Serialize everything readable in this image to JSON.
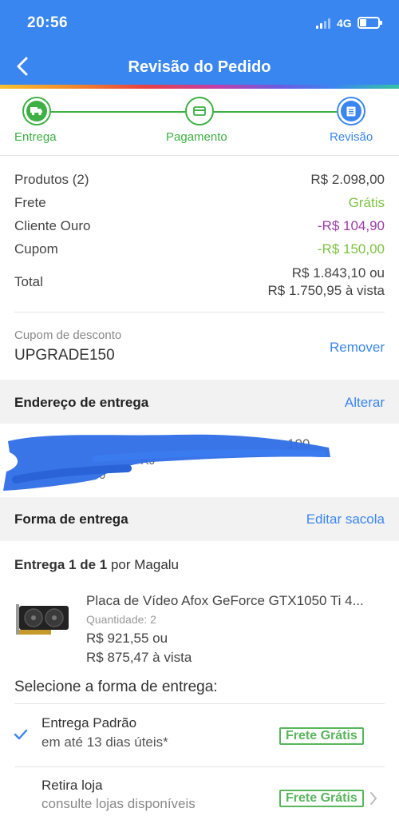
{
  "status": {
    "time": "20:56",
    "network": "4G"
  },
  "header": {
    "title": "Revisão do Pedido"
  },
  "colors": {
    "primary": "#3a86f0",
    "success": "#3cb043",
    "purple": "#9b3aa8",
    "free": "#7cc242"
  },
  "steps": [
    {
      "label": "Entrega",
      "icon": "truck-icon",
      "state": "done"
    },
    {
      "label": "Pagamento",
      "icon": "card-icon",
      "state": "done"
    },
    {
      "label": "Revisão",
      "icon": "list-icon",
      "state": "current"
    }
  ],
  "summary": {
    "products_label": "Produtos (2)",
    "products_value": "R$ 2.098,00",
    "shipping_label": "Frete",
    "shipping_value": "Grátis",
    "gold_label": "Cliente Ouro",
    "gold_value": "-R$ 104,90",
    "coupon_label": "Cupom",
    "coupon_value": "-R$ 150,00",
    "total_label": "Total",
    "total_value": "R$ 1.843,10 ou",
    "total_cash": "R$ 1.750,95 à vista"
  },
  "coupon": {
    "label": "Cupom de desconto",
    "code": "UPGRADE150",
    "remove": "Remover"
  },
  "address": {
    "title": "Endereço de entrega",
    "change": "Alterar",
    "number_fragment": "100",
    "state_fragment": "RJ",
    "zip_fragment": "0"
  },
  "delivery": {
    "title": "Forma de entrega",
    "edit": "Editar sacola",
    "shipment": "Entrega 1 de 1",
    "shipment_by": "por Magalu",
    "product": {
      "name": "Placa de Vídeo Afox GeForce GTX1050 Ti 4...",
      "quantity": "Quantidade: 2",
      "price": "R$ 921,55 ou",
      "price_cash": "R$ 875,47 à vista"
    },
    "select_title": "Selecione a forma de entrega:",
    "options": [
      {
        "name": "Entrega Padrão",
        "detail": "em até 13 dias úteis*",
        "badge": "Frete Grátis",
        "selected": true
      },
      {
        "name": "Retira loja",
        "detail": "consulte lojas disponíveis",
        "badge": "Frete Grátis",
        "selected": false
      }
    ]
  }
}
